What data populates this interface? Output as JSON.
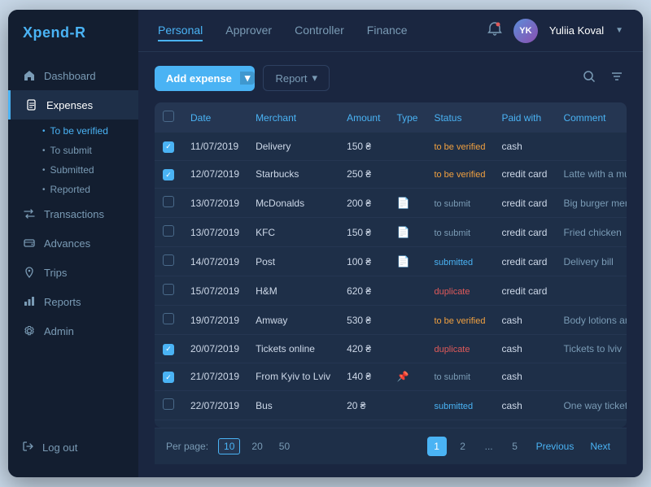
{
  "app": {
    "logo_prefix": "Xpend-",
    "logo_suffix": "R"
  },
  "sidebar": {
    "items": [
      {
        "id": "dashboard",
        "label": "Dashboard",
        "icon": "home"
      },
      {
        "id": "expenses",
        "label": "Expenses",
        "icon": "file",
        "active": true
      },
      {
        "id": "transactions",
        "label": "Transactions",
        "icon": "exchange"
      },
      {
        "id": "advances",
        "label": "Advances",
        "icon": "wallet"
      },
      {
        "id": "trips",
        "label": "Trips",
        "icon": "map"
      },
      {
        "id": "reports",
        "label": "Reports",
        "icon": "chart"
      },
      {
        "id": "admin",
        "label": "Admin",
        "icon": "gear"
      }
    ],
    "expense_sub": [
      {
        "id": "to-verify",
        "label": "To be verified",
        "active": true
      },
      {
        "id": "to-submit",
        "label": "To submit"
      },
      {
        "id": "submitted",
        "label": "Submitted"
      },
      {
        "id": "reported",
        "label": "Reported"
      }
    ],
    "logout_label": "Log out"
  },
  "header": {
    "tabs": [
      {
        "id": "personal",
        "label": "Personal",
        "active": true
      },
      {
        "id": "approver",
        "label": "Approver"
      },
      {
        "id": "controller",
        "label": "Controller"
      },
      {
        "id": "finance",
        "label": "Finance"
      }
    ],
    "user_name": "Yuliia Koval"
  },
  "toolbar": {
    "add_expense_label": "Add expense",
    "report_label": "Report"
  },
  "table": {
    "columns": [
      "",
      "Date",
      "Merchant",
      "Amount",
      "Type",
      "Status",
      "Paid with",
      "Comment"
    ],
    "rows": [
      {
        "checked": true,
        "date": "11/07/2019",
        "merchant": "Delivery",
        "amount": "150 ₴",
        "type": "",
        "status": "to be verified",
        "status_class": "status-verify",
        "paid_with": "cash",
        "comment": ""
      },
      {
        "checked": true,
        "date": "12/07/2019",
        "merchant": "Starbucks",
        "amount": "250 ₴",
        "type": "",
        "status": "to be verified",
        "status_class": "status-verify",
        "paid_with": "credit card",
        "comment": "Latte with a muffin"
      },
      {
        "checked": false,
        "date": "13/07/2019",
        "merchant": "McDonalds",
        "amount": "200 ₴",
        "type": "doc",
        "status": "to submit",
        "status_class": "status-submit",
        "paid_with": "credit card",
        "comment": "Big burger menu, cola light"
      },
      {
        "checked": false,
        "date": "13/07/2019",
        "merchant": "KFC",
        "amount": "150 ₴",
        "type": "doc",
        "status": "to submit",
        "status_class": "status-submit",
        "paid_with": "credit card",
        "comment": "Fried chicken"
      },
      {
        "checked": false,
        "date": "14/07/2019",
        "merchant": "Post",
        "amount": "100 ₴",
        "type": "doc",
        "status": "submitted",
        "status_class": "status-submitted",
        "paid_with": "credit card",
        "comment": "Delivery bill"
      },
      {
        "checked": false,
        "date": "15/07/2019",
        "merchant": "H&M",
        "amount": "620 ₴",
        "type": "",
        "status": "duplicate",
        "status_class": "status-duplicate",
        "paid_with": "credit card",
        "comment": ""
      },
      {
        "checked": false,
        "date": "19/07/2019",
        "merchant": "Amway",
        "amount": "530 ₴",
        "type": "",
        "status": "to be verified",
        "status_class": "status-verify",
        "paid_with": "cash",
        "comment": "Body lotions and scrub"
      },
      {
        "checked": true,
        "date": "20/07/2019",
        "merchant": "Tickets online",
        "amount": "420 ₴",
        "type": "",
        "status": "duplicate",
        "status_class": "status-duplicate",
        "paid_with": "cash",
        "comment": "Tickets to lviv"
      },
      {
        "checked": true,
        "date": "21/07/2019",
        "merchant": "From Kyiv to Lviv",
        "amount": "140 ₴",
        "type": "pin",
        "status": "to submit",
        "status_class": "status-submit",
        "paid_with": "cash",
        "comment": ""
      },
      {
        "checked": false,
        "date": "22/07/2019",
        "merchant": "Bus",
        "amount": "20 ₴",
        "type": "",
        "status": "submitted",
        "status_class": "status-submitted",
        "paid_with": "cash",
        "comment": "One way ticket"
      }
    ]
  },
  "pagination": {
    "per_page_label": "Per page:",
    "per_page_options": [
      "10",
      "20",
      "50"
    ],
    "per_page_active": "10",
    "pages": [
      "1",
      "2",
      "...",
      "5"
    ],
    "active_page": "1",
    "prev_label": "Previous",
    "next_label": "Next"
  }
}
